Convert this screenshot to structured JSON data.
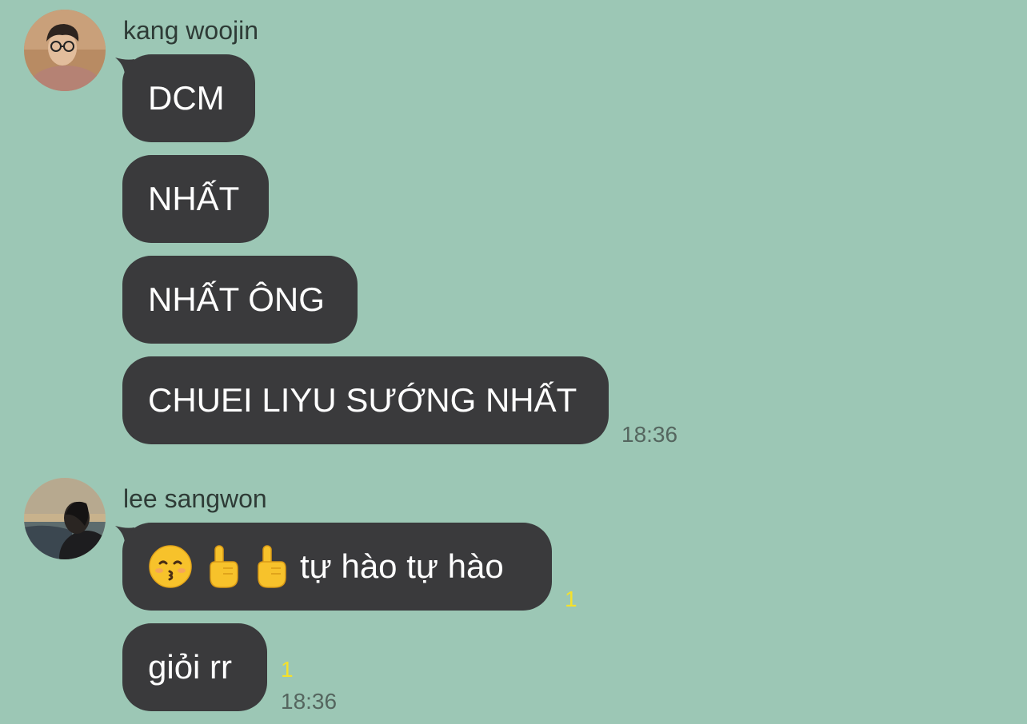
{
  "groups": [
    {
      "sender": "kang woojin",
      "messages": [
        "DCM",
        "NHẤT",
        "NHẤT ÔNG",
        "CHUEI LIYU SƯỚNG NHẤT"
      ],
      "time": "18:36"
    },
    {
      "sender": "lee sangwon",
      "messages": [
        {
          "emojis": [
            "kissing-face",
            "pointing-up-hand",
            "pointing-up-hand"
          ],
          "text": "tự hào tự hào",
          "unread": "1"
        },
        {
          "text": "giỏi rr",
          "unread": "1"
        }
      ],
      "time": "18:36"
    }
  ],
  "colors": {
    "background": "#9cc7b5",
    "bubble": "#3a3a3c",
    "bubble_text": "#ffffff",
    "unread_count": "#f5e12a",
    "timestamp": "#55665f"
  }
}
